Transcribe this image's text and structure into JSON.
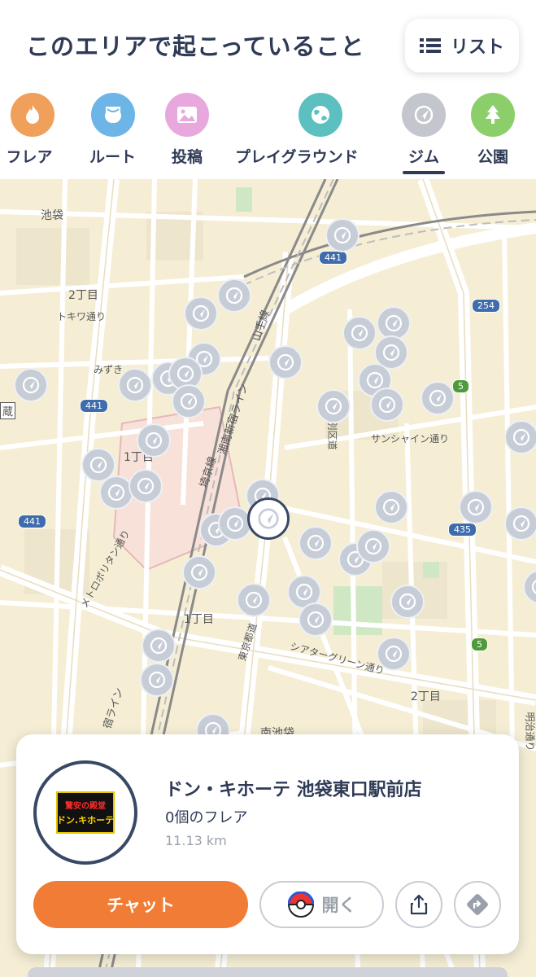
{
  "header": {
    "title": "このエリアで起こっていること",
    "list_label": "リスト"
  },
  "categories": [
    {
      "label": "フレア",
      "color": "#f0a05a",
      "icon": "flame-icon"
    },
    {
      "label": "ルート",
      "color": "#6db5e6",
      "icon": "route-icon"
    },
    {
      "label": "投稿",
      "color": "#e8a8dd",
      "icon": "image-icon"
    },
    {
      "label": "プレイグラウンド",
      "color": "#5cc0c0",
      "icon": "globe-icon"
    },
    {
      "label": "ジム",
      "color": "#c3c6cc",
      "icon": "gym-icon",
      "active": true
    },
    {
      "label": "公園",
      "color": "#8ccf6a",
      "icon": "tree-icon"
    }
  ],
  "map": {
    "labels": {
      "ikebukuro": "池袋",
      "nichome_nw": "2丁目",
      "tokiwa": "トキワ通り",
      "mizuki": "みずき",
      "itchome_w": "1丁目",
      "metropolitan": "メトロポリタン通り",
      "itchome_s": "1丁目",
      "yamanote": "山手線",
      "shonan": "湘南新宿ライン",
      "saikyo": "埼京線",
      "sunshine": "サンシャイン通り",
      "tokubetsu": "特別区道",
      "higashi_ikebukuro": "東京都道",
      "theater_green": "シアターグリーン通り",
      "nichome_se": "2丁目",
      "minami_ikebukuro": "南池袋",
      "meiji": "明治通り",
      "shinjuku_line": "宿ライン",
      "kura": "蔵"
    },
    "routes": [
      "441",
      "441",
      "441",
      "254",
      "5",
      "435",
      "5"
    ]
  },
  "card": {
    "name": "ドン・キホーテ 池袋東口駅前店",
    "flares": "0個のフレア",
    "distance": "11.13 km",
    "logo_line1": "驚安の殿堂",
    "logo_line2": "ドン.キホーテ",
    "chat_label": "チャット",
    "open_label": "開く"
  }
}
